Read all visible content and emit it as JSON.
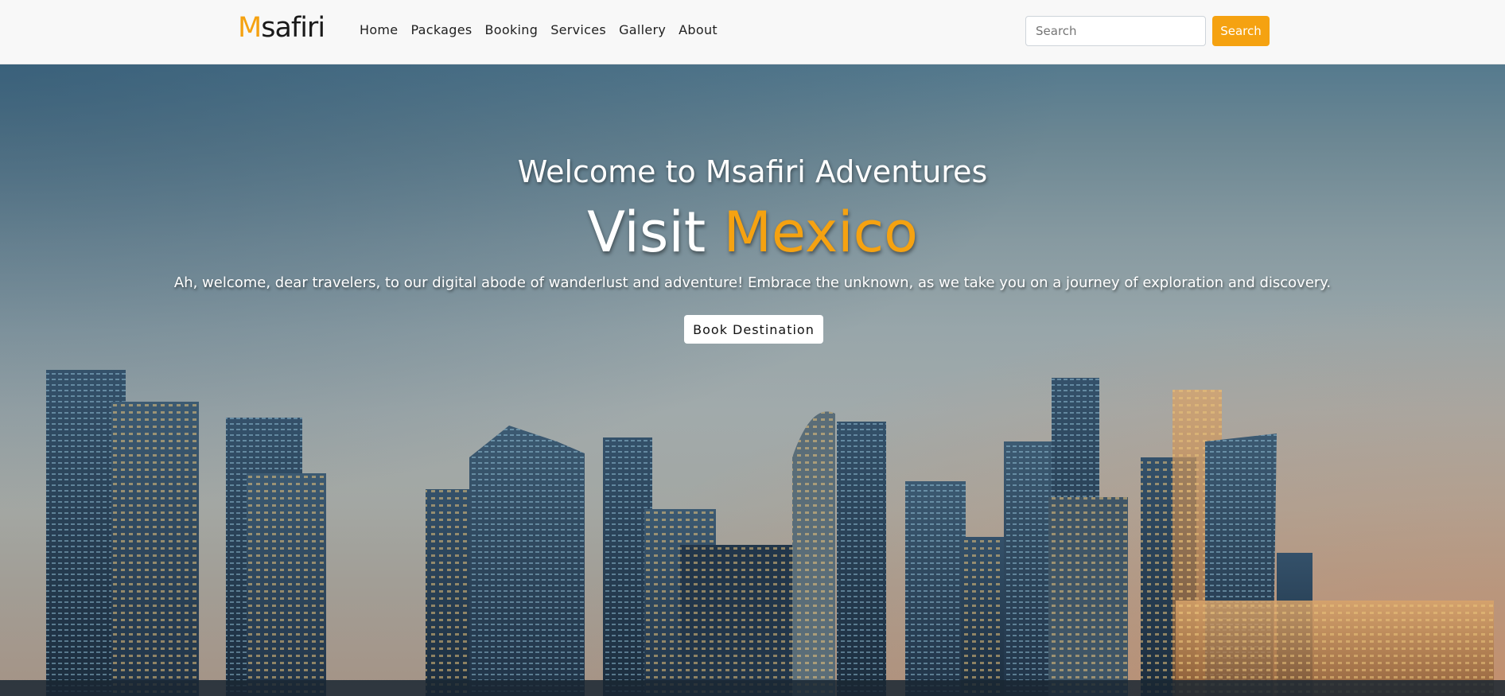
{
  "nav": {
    "brand_first": "M",
    "brand_rest": "safiri",
    "links": [
      {
        "label": "Home"
      },
      {
        "label": "Packages"
      },
      {
        "label": "Booking"
      },
      {
        "label": "Services"
      },
      {
        "label": "Gallery"
      },
      {
        "label": "About"
      }
    ],
    "search_placeholder": "Search",
    "search_button": "Search"
  },
  "hero": {
    "welcome": "Welcome to Msafiri Adventures",
    "visit_prefix": "Visit ",
    "destination": "Mexico",
    "description": "Ah, welcome, dear travelers, to our digital abode of wanderlust and adventure! Embrace the unknown, as we take you on a journey of exploration and discovery.",
    "cta_label": "Book Destination",
    "background": "city-skyline-dusk"
  },
  "colors": {
    "accent": "#f5a211",
    "navbar_bg": "#f8f8f8",
    "text_dark": "#1f1f1f",
    "white": "#ffffff"
  }
}
